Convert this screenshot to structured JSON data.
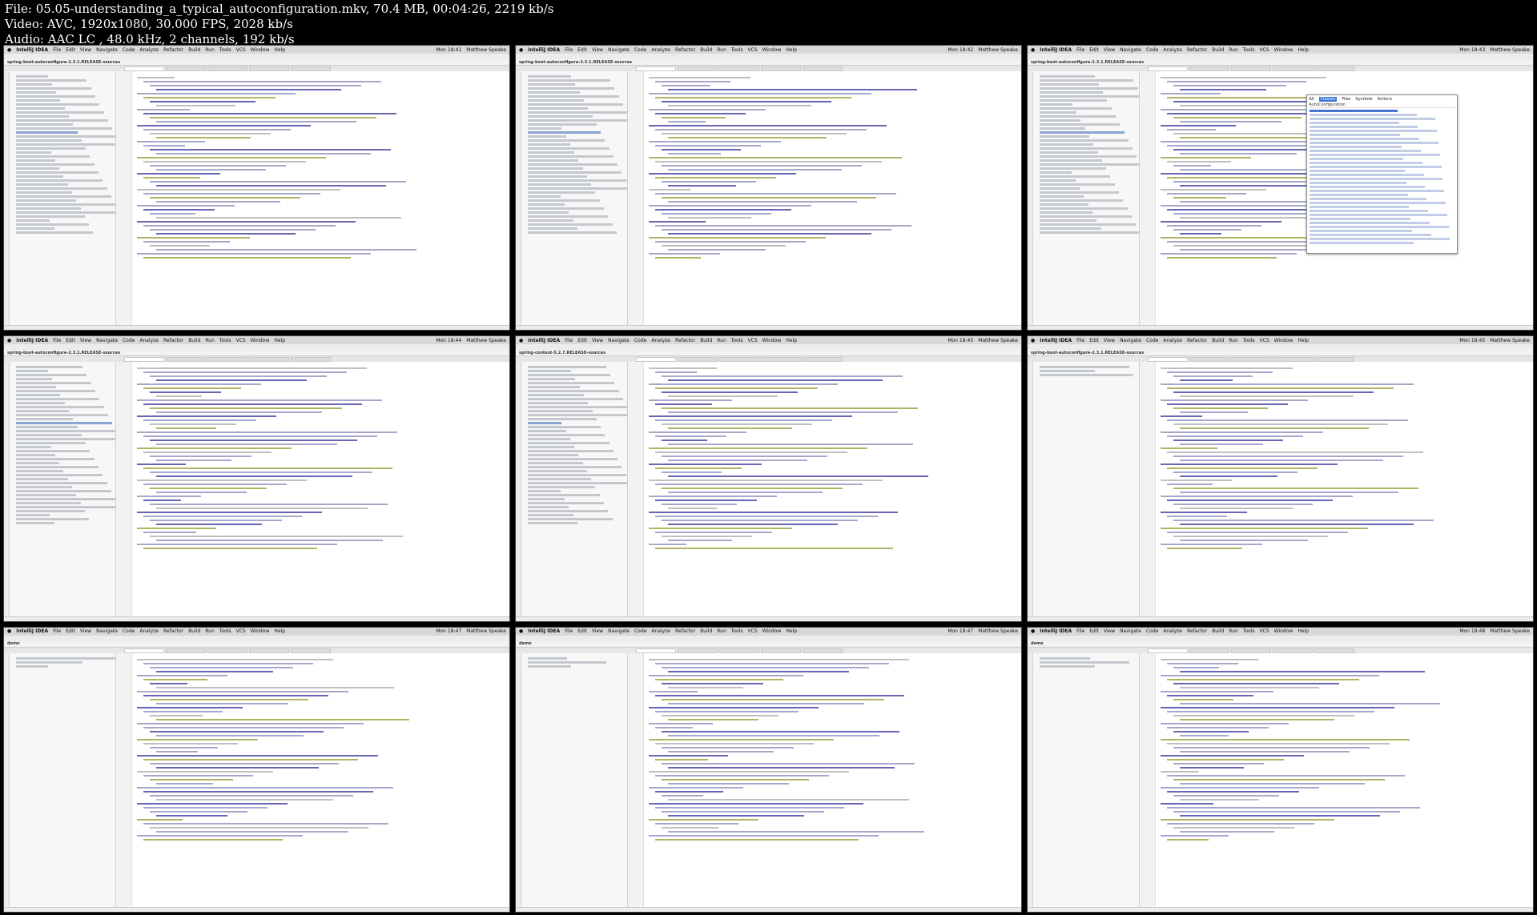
{
  "file_info": {
    "file": "File: 05.05-understanding_a_typical_autoconfiguration.mkv, 70.4 MB, 00:04:26, 2219 kb/s",
    "video": "Video: AVC, 1920x1080, 30.000 FPS, 2028 kb/s",
    "audio": "Audio: AAC LC , 48.0 kHz, 2 channels, 192 kb/s"
  },
  "frames": [
    {
      "app": "IntelliJ IDEA",
      "menus": [
        "File",
        "Edit",
        "View",
        "Navigate",
        "Code",
        "Analyze",
        "Refactor",
        "Build",
        "Run",
        "Tools",
        "VCS",
        "Window",
        "Help"
      ],
      "clock": "Mon 18:41",
      "user": "Matthew Speake",
      "project": "spring-boot-autoconfigure-2.3.1.RELEASE-sources",
      "layout": "tree",
      "popup": false
    },
    {
      "app": "IntelliJ IDEA",
      "menus": [
        "File",
        "Edit",
        "View",
        "Navigate",
        "Code",
        "Analyze",
        "Refactor",
        "Build",
        "Run",
        "Tools",
        "VCS",
        "Window",
        "Help"
      ],
      "clock": "Mon 18:42",
      "user": "Matthew Speake",
      "project": "spring-boot-autoconfigure-2.3.1.RELEASE-sources",
      "layout": "tree",
      "popup": false
    },
    {
      "app": "IntelliJ IDEA",
      "menus": [
        "File",
        "Edit",
        "View",
        "Navigate",
        "Code",
        "Analyze",
        "Refactor",
        "Build",
        "Run",
        "Tools",
        "VCS",
        "Window",
        "Help"
      ],
      "clock": "Mon 18:43",
      "user": "Matthew Speake",
      "project": "spring-boot-autoconfigure-2.3.1.RELEASE-sources",
      "layout": "tree",
      "popup": true,
      "popup_tabs": [
        "All",
        "Classes",
        "Files",
        "Symbols",
        "Actions"
      ],
      "popup_query": "AutoConfiguration"
    },
    {
      "app": "IntelliJ IDEA",
      "menus": [
        "File",
        "Edit",
        "View",
        "Navigate",
        "Code",
        "Analyze",
        "Refactor",
        "Build",
        "Run",
        "Tools",
        "VCS",
        "Window",
        "Help"
      ],
      "clock": "Mon 18:44",
      "user": "Matthew Speake",
      "project": "spring-boot-autoconfigure-2.3.1.RELEASE-sources",
      "layout": "tree",
      "popup": false
    },
    {
      "app": "IntelliJ IDEA",
      "menus": [
        "File",
        "Edit",
        "View",
        "Navigate",
        "Code",
        "Analyze",
        "Refactor",
        "Build",
        "Run",
        "Tools",
        "VCS",
        "Window",
        "Help"
      ],
      "clock": "Mon 18:45",
      "user": "Matthew Speake",
      "project": "spring-context-5.2.7.RELEASE-sources",
      "layout": "tree",
      "popup": false
    },
    {
      "app": "IntelliJ IDEA",
      "menus": [
        "File",
        "Edit",
        "View",
        "Navigate",
        "Code",
        "Analyze",
        "Refactor",
        "Build",
        "Run",
        "Tools",
        "VCS",
        "Window",
        "Help"
      ],
      "clock": "Mon 18:45",
      "user": "Matthew Speake",
      "project": "spring-boot-autoconfigure-2.3.1.RELEASE-sources",
      "layout": "short",
      "popup": false
    },
    {
      "app": "IntelliJ IDEA",
      "menus": [
        "File",
        "Edit",
        "View",
        "Navigate",
        "Code",
        "Analyze",
        "Refactor",
        "Build",
        "Run",
        "Tools",
        "VCS",
        "Window",
        "Help"
      ],
      "clock": "Mon 18:47",
      "user": "Matthew Speake",
      "project": "demo",
      "layout": "short",
      "popup": false
    },
    {
      "app": "IntelliJ IDEA",
      "menus": [
        "File",
        "Edit",
        "View",
        "Navigate",
        "Code",
        "Analyze",
        "Refactor",
        "Build",
        "Run",
        "Tools",
        "VCS",
        "Window",
        "Help"
      ],
      "clock": "Mon 18:47",
      "user": "Matthew Speake",
      "project": "demo",
      "layout": "short",
      "popup": false
    },
    {
      "app": "IntelliJ IDEA",
      "menus": [
        "File",
        "Edit",
        "View",
        "Navigate",
        "Code",
        "Analyze",
        "Refactor",
        "Build",
        "Run",
        "Tools",
        "VCS",
        "Window",
        "Help"
      ],
      "clock": "Mon 18:48",
      "user": "Matthew Speake",
      "project": "demo",
      "layout": "short",
      "popup": false
    }
  ]
}
